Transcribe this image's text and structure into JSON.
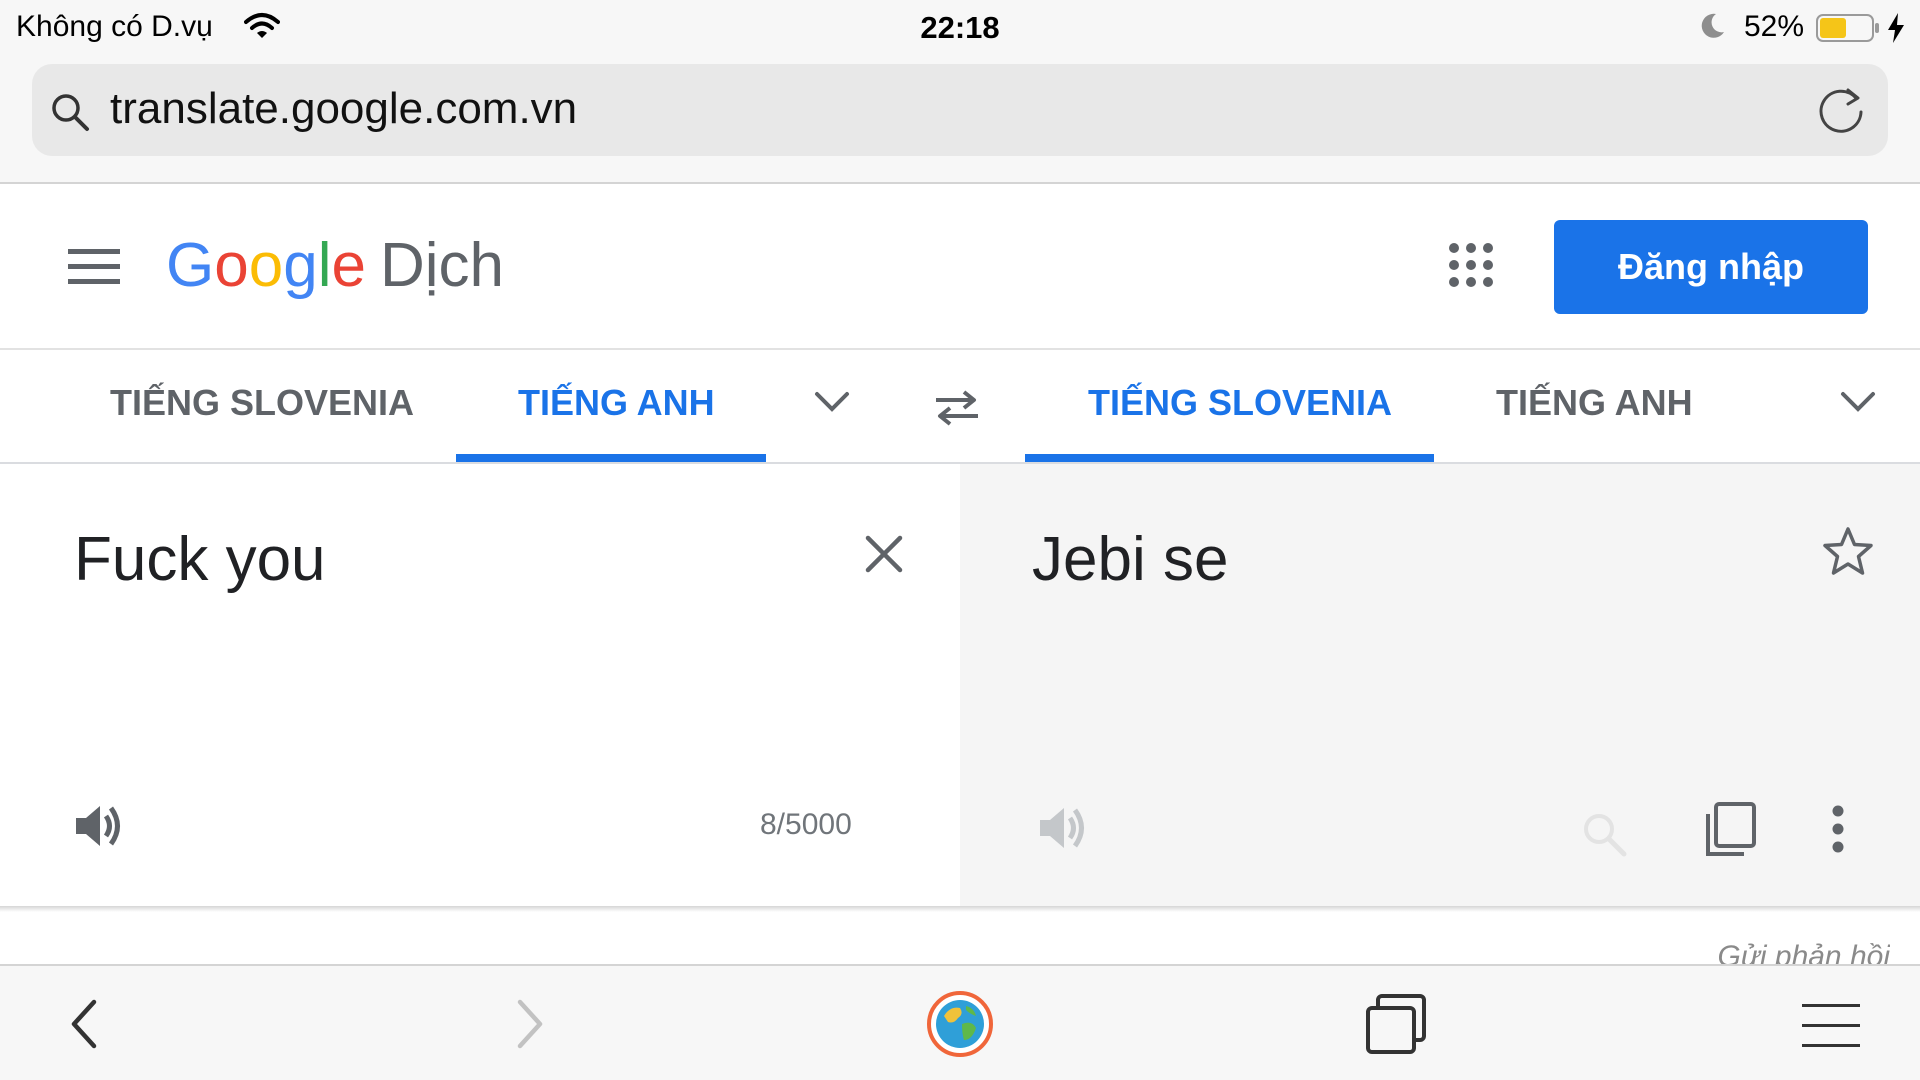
{
  "status_bar": {
    "carrier": "Không có D.vụ",
    "time": "22:18",
    "battery_percent": "52%",
    "battery_level": 0.52,
    "battery_color": "#f5c518"
  },
  "browser": {
    "url": "translate.google.com.vn",
    "icons": [
      "search-icon",
      "reload-icon"
    ]
  },
  "header": {
    "logo_letters": [
      "G",
      "o",
      "o",
      "g",
      "l",
      "e"
    ],
    "product": "Dịch",
    "signin_label": "Đăng nhập",
    "brand_color": "#1a73e8"
  },
  "language_bar": {
    "source": [
      "TIẾNG SLOVENIA",
      "TIẾNG ANH"
    ],
    "source_selected": "TIẾNG ANH",
    "target": [
      "TIẾNG SLOVENIA",
      "TIẾNG ANH"
    ],
    "target_selected": "TIẾNG SLOVENIA"
  },
  "source_pane": {
    "text": "Fuck you",
    "char_count": "8/5000"
  },
  "target_pane": {
    "text": "Jebi se"
  },
  "footer": {
    "feedback": "Gửi phản hồi"
  }
}
